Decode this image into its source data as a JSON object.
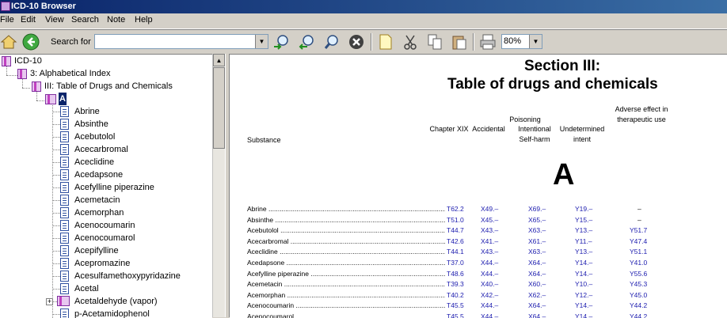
{
  "window": {
    "title": "ICD-10 Browser"
  },
  "menu": [
    "File",
    "Edit",
    "View",
    "Search",
    "Note",
    "Help"
  ],
  "toolbar": {
    "search_label": "Search for",
    "search_value": "",
    "zoom": "80%"
  },
  "tree": {
    "root": "ICD-10",
    "level1": "3: Alphabetical Index",
    "level2": "III: Table of Drugs and Chemicals",
    "level3": "A",
    "items": [
      "Abrine",
      "Absinthe",
      "Acebutolol",
      "Acecarbromal",
      "Aceclidine",
      "Acedapsone",
      "Acefylline piperazine",
      "Acemetacin",
      "Acemorphan",
      "Acenocoumarin",
      "Acenocoumarol",
      "Acepifylline",
      "Acepromazine",
      "Acesulfamethoxypyridazine",
      "Acetal",
      "Acetaldehyde (vapor)",
      "p-Acetamidophenol"
    ]
  },
  "document": {
    "title": "Section III:",
    "subtitle": "Table of drugs and chemicals",
    "headers": {
      "substance": "Substance",
      "chapter": "Chapter XIX",
      "poisoning": "Poisoning",
      "accidental": "Accidental",
      "intentional": "Intentional Self-harm",
      "undetermined": "Undetermined intent",
      "adverse": "Adverse effect in therapeutic use"
    },
    "letter": "A",
    "rows": [
      {
        "name": "Abrine",
        "chapter": "T62.2",
        "acc": "X49.–",
        "self": "X69.–",
        "und": "Y19.–",
        "adv": "–"
      },
      {
        "name": "Absinthe",
        "chapter": "T51.0",
        "acc": "X45.–",
        "self": "X65.–",
        "und": "Y15.–",
        "adv": "–"
      },
      {
        "name": "Acebutolol",
        "chapter": "T44.7",
        "acc": "X43.–",
        "self": "X63.–",
        "und": "Y13.–",
        "adv": "Y51.7"
      },
      {
        "name": "Acecarbromal",
        "chapter": "T42.6",
        "acc": "X41.–",
        "self": "X61.–",
        "und": "Y11.–",
        "adv": "Y47.4"
      },
      {
        "name": "Aceclidine",
        "chapter": "T44.1",
        "acc": "X43.–",
        "self": "X63.–",
        "und": "Y13.–",
        "adv": "Y51.1"
      },
      {
        "name": "Acedapsone",
        "chapter": "T37.0",
        "acc": "X44.–",
        "self": "X64.–",
        "und": "Y14.–",
        "adv": "Y41.0"
      },
      {
        "name": "Acefylline piperazine",
        "chapter": "T48.6",
        "acc": "X44.–",
        "self": "X64.–",
        "und": "Y14.–",
        "adv": "Y55.6"
      },
      {
        "name": "Acemetacin",
        "chapter": "T39.3",
        "acc": "X40.–",
        "self": "X60.–",
        "und": "Y10.–",
        "adv": "Y45.3"
      },
      {
        "name": "Acemorphan",
        "chapter": "T40.2",
        "acc": "X42.–",
        "self": "X62.–",
        "und": "Y12.–",
        "adv": "Y45.0"
      },
      {
        "name": "Acenocoumarin",
        "chapter": "T45.5",
        "acc": "X44.–",
        "self": "X64.–",
        "und": "Y14.–",
        "adv": "Y44.2"
      },
      {
        "name": "Acenocoumarol",
        "chapter": "T45.5",
        "acc": "X44.–",
        "self": "X64.–",
        "und": "Y14.–",
        "adv": "Y44.2"
      }
    ]
  }
}
